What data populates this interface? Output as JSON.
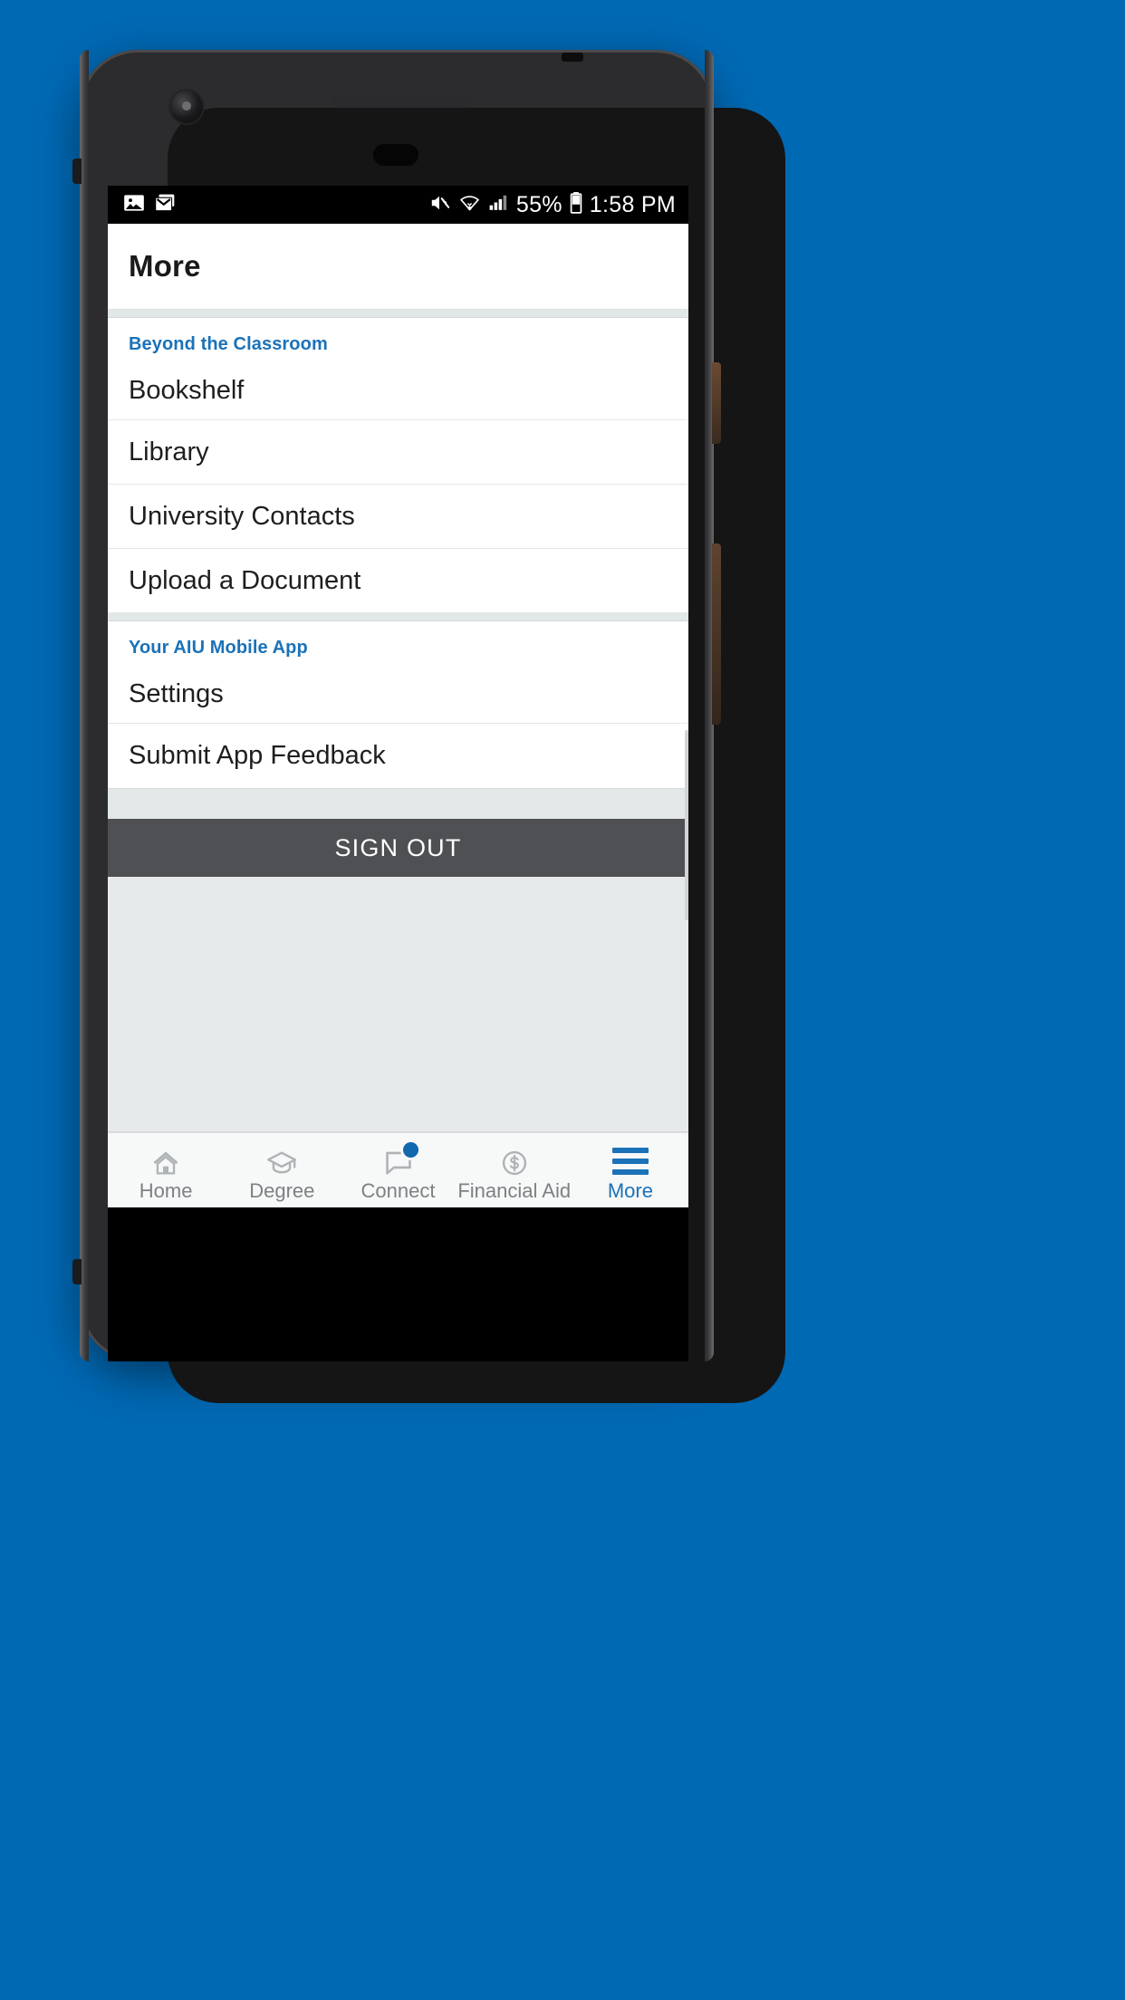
{
  "status_bar": {
    "left_icons": [
      "image-icon",
      "email-icon"
    ],
    "mute_icon": "volume-mute-icon",
    "wifi_icon": "wifi-icon",
    "signal_icon": "cellular-signal-icon",
    "battery_percent": "55%",
    "battery_icon": "battery-icon",
    "time": "1:58 PM"
  },
  "app_bar": {
    "title": "More"
  },
  "sections": [
    {
      "header": "Beyond the Classroom",
      "items": [
        {
          "label": "Bookshelf"
        },
        {
          "label": "Library"
        },
        {
          "label": "University Contacts"
        },
        {
          "label": "Upload a Document"
        }
      ]
    },
    {
      "header": "Your AIU Mobile App",
      "items": [
        {
          "label": "Settings"
        },
        {
          "label": "Submit App Feedback"
        }
      ]
    }
  ],
  "sign_out": {
    "label": "SIGN OUT"
  },
  "tab_bar": {
    "tabs": [
      {
        "label": "Home",
        "icon": "home-icon",
        "active": false,
        "badge": false
      },
      {
        "label": "Degree",
        "icon": "graduation-cap-icon",
        "active": false,
        "badge": false
      },
      {
        "label": "Connect",
        "icon": "chat-bubble-icon",
        "active": false,
        "badge": true
      },
      {
        "label": "Financial Aid",
        "icon": "dollar-circle-icon",
        "active": false,
        "badge": false
      },
      {
        "label": "More",
        "icon": "hamburger-menu-icon",
        "active": true,
        "badge": false
      }
    ]
  },
  "colors": {
    "accent_blue": "#1b72b8",
    "background_blue": "#0069b4",
    "sign_out_gray": "#4f5053",
    "screen_gray": "#e6eaea"
  }
}
